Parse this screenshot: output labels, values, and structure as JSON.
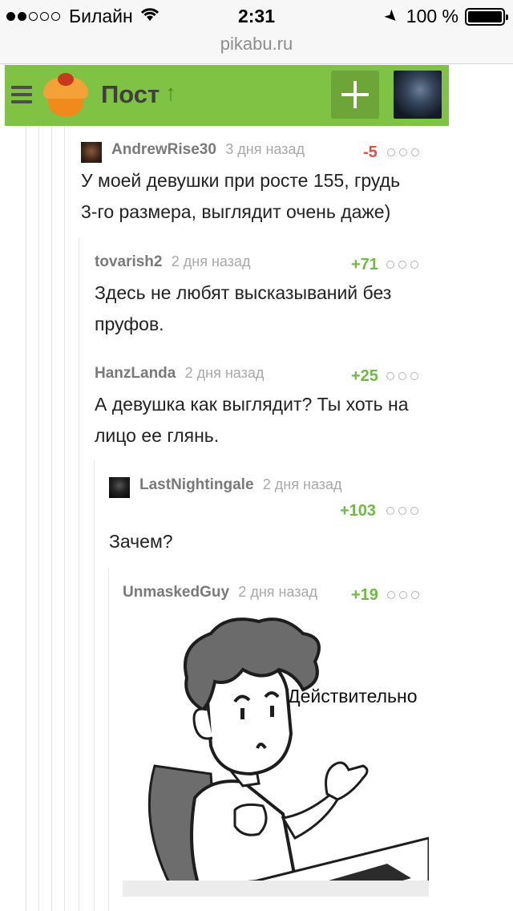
{
  "status_bar": {
    "signal": "●●○○○",
    "carrier": "Билайн",
    "wifi_icon": "wifi-icon",
    "time": "2:31",
    "location_icon": "location-arrow-icon",
    "battery_percent": "100 %",
    "battery_level": 1.0
  },
  "browser": {
    "url": "pikabu.ru"
  },
  "header": {
    "background": "#80c243",
    "title": "Пост",
    "title_arrow": "↑",
    "menu_icon": "hamburger-icon",
    "logo_icon": "cupcake-logo-icon",
    "add_icon": "plus-icon"
  },
  "comments": [
    {
      "author": "AndrewRise30",
      "time": "3 дня назад",
      "rating": "-5",
      "text_lines": [
        "У моей девушки при росте 155, грудь",
        "3-го размера, выглядит очень даже)"
      ]
    },
    {
      "author": "tovarish2",
      "time": "2 дня назад",
      "rating": "+71",
      "text_lines": [
        "Здесь не любят высказываний без",
        "пруфов."
      ]
    },
    {
      "author": "HanzLanda",
      "time": "2 дня назад",
      "rating": "+25",
      "text_lines": [
        "А девушка как выглядит? Ты хоть на",
        "лицо ее глянь."
      ]
    },
    {
      "author": "LastNightingale",
      "time": "2 дня назад",
      "rating": "+103",
      "text_lines": [
        "Зачем?"
      ]
    },
    {
      "author": "UnmaskedGuy",
      "time": "2 дня назад",
      "rating": "+19",
      "meme_caption": "Действительно"
    }
  ],
  "colors": {
    "positive": "#6fba44",
    "negative": "#e94b3c"
  }
}
